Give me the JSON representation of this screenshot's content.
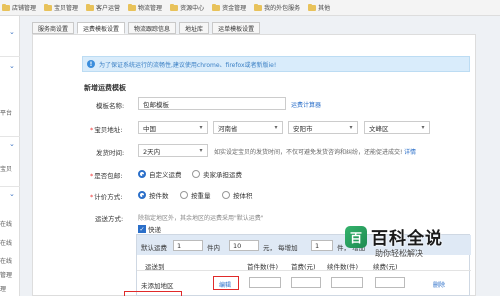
{
  "topbar": {
    "items": [
      "店铺管理",
      "宝贝管理",
      "客户运营",
      "物流管理",
      "资源中心",
      "资金管理",
      "我的外包服务",
      "其他"
    ]
  },
  "leftnav": {
    "labels": [
      "平台",
      "宝贝",
      "在线",
      "在线",
      "在线",
      "管理",
      "理"
    ]
  },
  "tabs": [
    "服务商设置",
    "运费模板设置",
    "物流跟踪信息",
    "地址库",
    "运单模板设置"
  ],
  "notice": {
    "icon": "info-icon",
    "text": "为了保证系统运行的流畅性,建议使用chrome、firefox或者新版ie!"
  },
  "form": {
    "section_title": "新增运费模板",
    "template_name": {
      "label": "模板名称:",
      "value": "包邮模板",
      "link": "运费计算器"
    },
    "address": {
      "label": "宝贝地址:",
      "country": "中国",
      "province": "河南省",
      "city": "安阳市",
      "district": "文峰区"
    },
    "ship_time": {
      "label": "发货时间:",
      "value": "2天内",
      "hint": "如实设定宝贝的发货时间，不仅可避免发货咨询和纠纷，还能促进成交!",
      "link": "详情"
    },
    "free_shipping": {
      "label": "是否包邮:",
      "options": [
        "自定义运费",
        "卖家承担运费"
      ],
      "selected": 0
    },
    "pricing": {
      "label": "计价方式:",
      "options": [
        "按件数",
        "按重量",
        "按体积"
      ],
      "selected": 0
    },
    "shipping_method": {
      "label": "运送方式:",
      "hint": "除指定地区外，其余地区的运费采用\"默认运费\"",
      "express_label": "快递"
    }
  },
  "ship_table": {
    "default_label": "默认运费",
    "first_qty": "1",
    "unit1": "件内",
    "first_fee": "10",
    "unit2": "元，  每增加",
    "add_qty": "1",
    "unit3": "件，  增加",
    "headers": [
      "运送到",
      "首件数(件)",
      "首费(元)",
      "续件数(件)",
      "续费(元)"
    ],
    "row_region": "未添加地区",
    "edit_label": "编辑",
    "delete_label": "删除"
  },
  "watermark": {
    "title": "百科全说",
    "subtitle": "助你轻松解决"
  }
}
